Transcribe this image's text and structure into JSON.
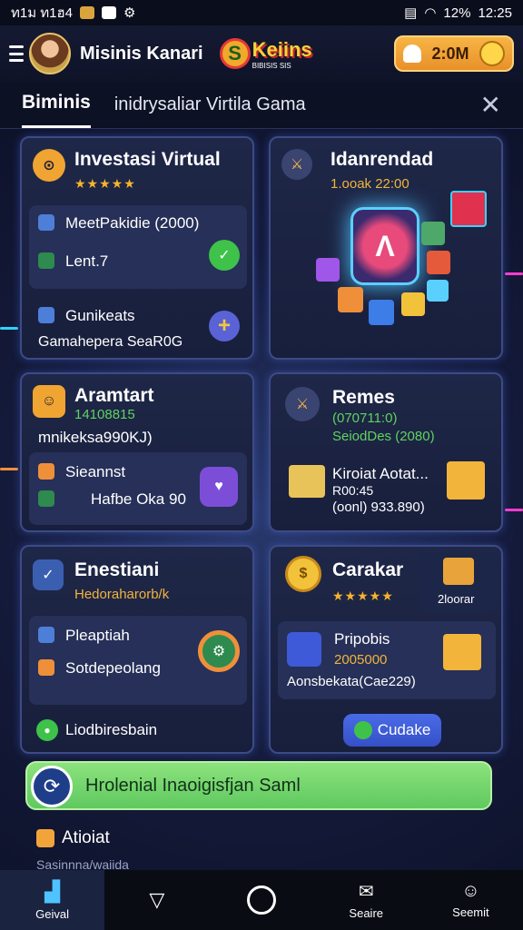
{
  "status_bar": {
    "left_text": "ท1ม ท1ฮ4",
    "battery": "12%",
    "time": "12:25"
  },
  "header": {
    "username": "Misinis Kanari",
    "logo_text": "Keiins",
    "logo_sub": "BIBISIS SIS",
    "coins": "2:0M"
  },
  "tabs": {
    "active": "Biminis",
    "title": "inidrysaliar Virtila Gama"
  },
  "cards": {
    "c1": {
      "title": "Investasi Virtual",
      "stars": "★★★★★",
      "row1": "MeetPakidie (2000)",
      "row2": "Lent.7",
      "row3": "Gunikeats",
      "row4": "Gamahepera SeaR0G"
    },
    "c2": {
      "title": "Idanrendad",
      "subtitle": "1.ooak 22:00"
    },
    "c3": {
      "title": "Aramtart",
      "subtitle": "14108815",
      "line": "mnikeksa990KJ)",
      "row1": "Sieannst",
      "row2": "Hafbe Oka 90"
    },
    "c4": {
      "title": "Remes",
      "subtitle": "(070711:0)",
      "line": "SeiodDes (2080)",
      "row1": "Kiroiat Aotat...",
      "row2": "R00:45",
      "row3": "(oonl) 933.890)"
    },
    "c5": {
      "title": "Enestiani",
      "subtitle": "Hedoraharorb/k",
      "row1": "Pleaptiah",
      "row2": "Sotdepeolang",
      "row3": "Liodbiresbain"
    },
    "c6": {
      "title": "Carakar",
      "stars": "★★★★★",
      "badge": "2loorar",
      "row1": "Pripobis",
      "row2": "2005000",
      "row3": "Aonsbekata(Cae229)",
      "button": "Cudake"
    }
  },
  "banner": {
    "text": "Hrolenial Inaoigisfjan Saml"
  },
  "footer_item": {
    "text": "Atioiat",
    "sub": "Sasinnna/waiida"
  },
  "nav": [
    {
      "label": "Geival"
    },
    {
      "label": ""
    },
    {
      "label": ""
    },
    {
      "label": "Seaire"
    },
    {
      "label": "Seemit"
    }
  ],
  "colors": {
    "accent": "#f7b545",
    "card_border": "#3d4a86",
    "banner": "#5fc95f"
  }
}
